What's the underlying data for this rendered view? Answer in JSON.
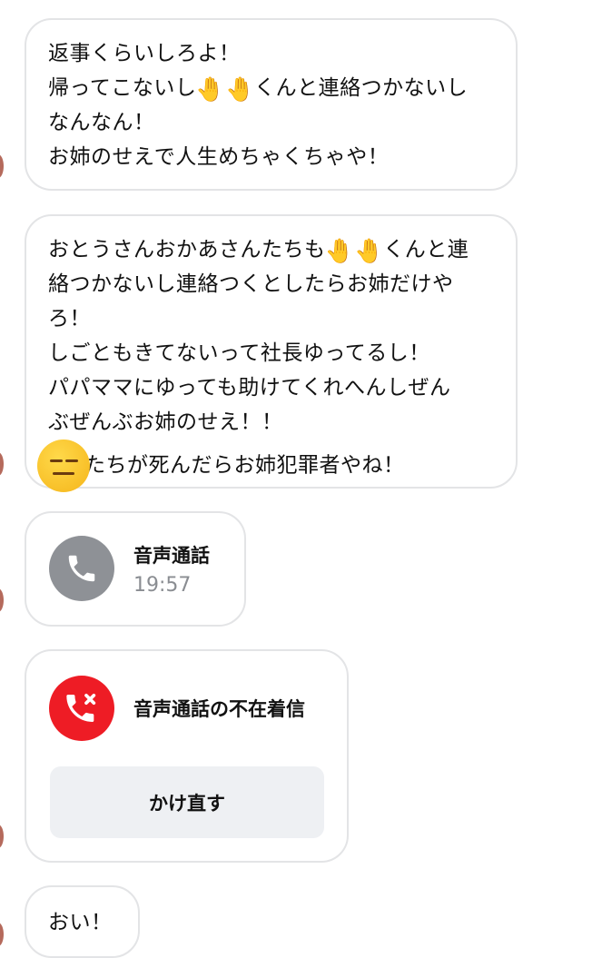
{
  "messages": [
    {
      "lines": [
        {
          "before": "返事くらいしろよ！",
          "emoji": "",
          "after": ""
        },
        {
          "before": "帰ってこないし",
          "emoji": "🤚🤚",
          "after": "くんと連絡つかないし"
        },
        {
          "before": "なんなん！",
          "emoji": "",
          "after": ""
        },
        {
          "before": "お姉のせえで人生めちゃくちゃや！",
          "emoji": "",
          "after": ""
        }
      ]
    },
    {
      "lines": [
        {
          "before": "おとうさんおかあさんたちも",
          "emoji": "🤚🤚",
          "after": "くんと連"
        },
        {
          "before": "絡つかないし連絡つくとしたらお姉だけや",
          "emoji": "",
          "after": ""
        },
        {
          "before": "ろ！",
          "emoji": "",
          "after": ""
        },
        {
          "before": "しごともきてないって社長ゆってるし！",
          "emoji": "",
          "after": ""
        },
        {
          "before": "パパママにゆっても助けてくれへんしぜん",
          "emoji": "",
          "after": ""
        },
        {
          "before": "ぶぜんぶお姉のせえ！！",
          "emoji": "",
          "after": ""
        },
        {
          "before": "",
          "emoji": "expressionless-face",
          "after": "たちが死んだらお姉犯罪者やね！"
        }
      ]
    }
  ],
  "voice_call": {
    "title": "音声通話",
    "time": "19:57",
    "icon": "phone-icon",
    "icon_color": "#8e9196"
  },
  "missed_call": {
    "title": "音声通話の不在着信",
    "button_label": "かけ直す",
    "icon": "missed-call-icon",
    "icon_color": "#ee1c25"
  },
  "last_message": {
    "text": "おい！"
  },
  "colors": {
    "bubble_border": "#e3e4e6",
    "button_bg": "#eef0f3",
    "secondary_text": "#8a8d92"
  }
}
